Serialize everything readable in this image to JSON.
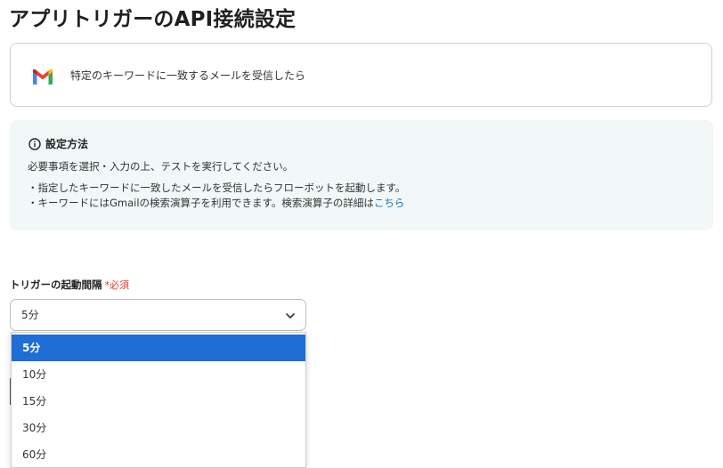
{
  "page": {
    "title": "アプリトリガーのAPI接続設定"
  },
  "trigger": {
    "app_icon": "gmail-icon",
    "label": "特定のキーワードに一致するメールを受信したら"
  },
  "info": {
    "icon": "info-icon",
    "title": "設定方法",
    "line1": "必要事項を選択・入力の上、テストを実行してください。",
    "line2": "・指定したキーワードに一致したメールを受信したらフローボットを起動します。",
    "line3_prefix": "・キーワードにはGmailの検索演算子を利用できます。検索演算子の詳細は",
    "line3_link": "こちら"
  },
  "interval_field": {
    "label": "トリガーの起動間隔",
    "required_text": "必須",
    "selected_value": "5分",
    "options": [
      "5分",
      "10分",
      "15分",
      "30分",
      "60分"
    ]
  },
  "colors": {
    "accent": "#1e6ed6",
    "info_bg": "#f1f8f7",
    "required": "#e53935",
    "link": "#1a73b8"
  }
}
